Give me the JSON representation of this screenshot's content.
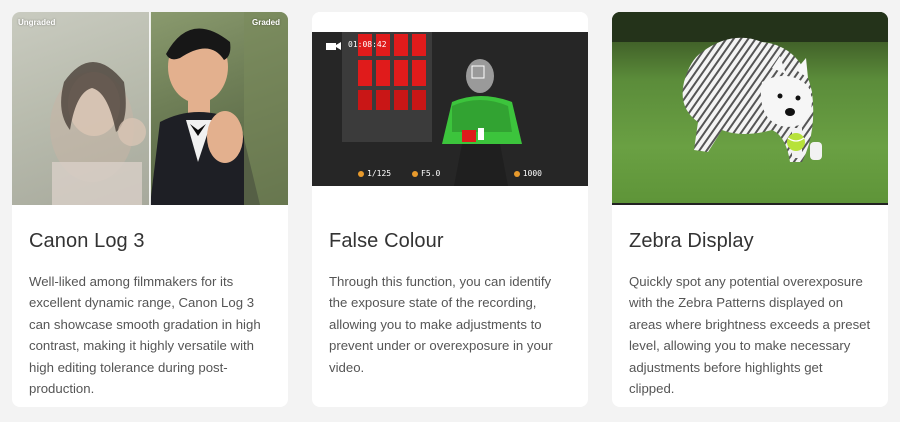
{
  "cards": [
    {
      "title": "Canon Log 3",
      "description": "Well-liked among filmmakers for its excellent dynamic range, Canon Log 3 can showcase smooth gradation in high contrast, making it highly versatile with high editing tolerance during post-production.",
      "image": {
        "left_label": "Ungraded",
        "right_label": "Graded"
      }
    },
    {
      "title": "False Colour",
      "description": "Through this function, you can identify the exposure state of the recording, allowing you to make adjustments to prevent under or overexposure in your video.",
      "image": {
        "timecode": "01:08:42",
        "shutter": "1/125",
        "fstop": "F5.0",
        "iso": "1000"
      }
    },
    {
      "title": "Zebra Display",
      "description": "Quickly spot any potential overexposure with the Zebra Patterns displayed on areas where brightness exceeds a preset level, allowing you to make necessary adjustments before highlights get clipped.",
      "image": {}
    }
  ],
  "colors": {
    "page_background": "#f3f3f3",
    "card_background": "#ffffff",
    "title_text": "#333333",
    "body_text": "#555555",
    "false_colour_red": "#e01b1b",
    "false_colour_green": "#3cc43c"
  }
}
